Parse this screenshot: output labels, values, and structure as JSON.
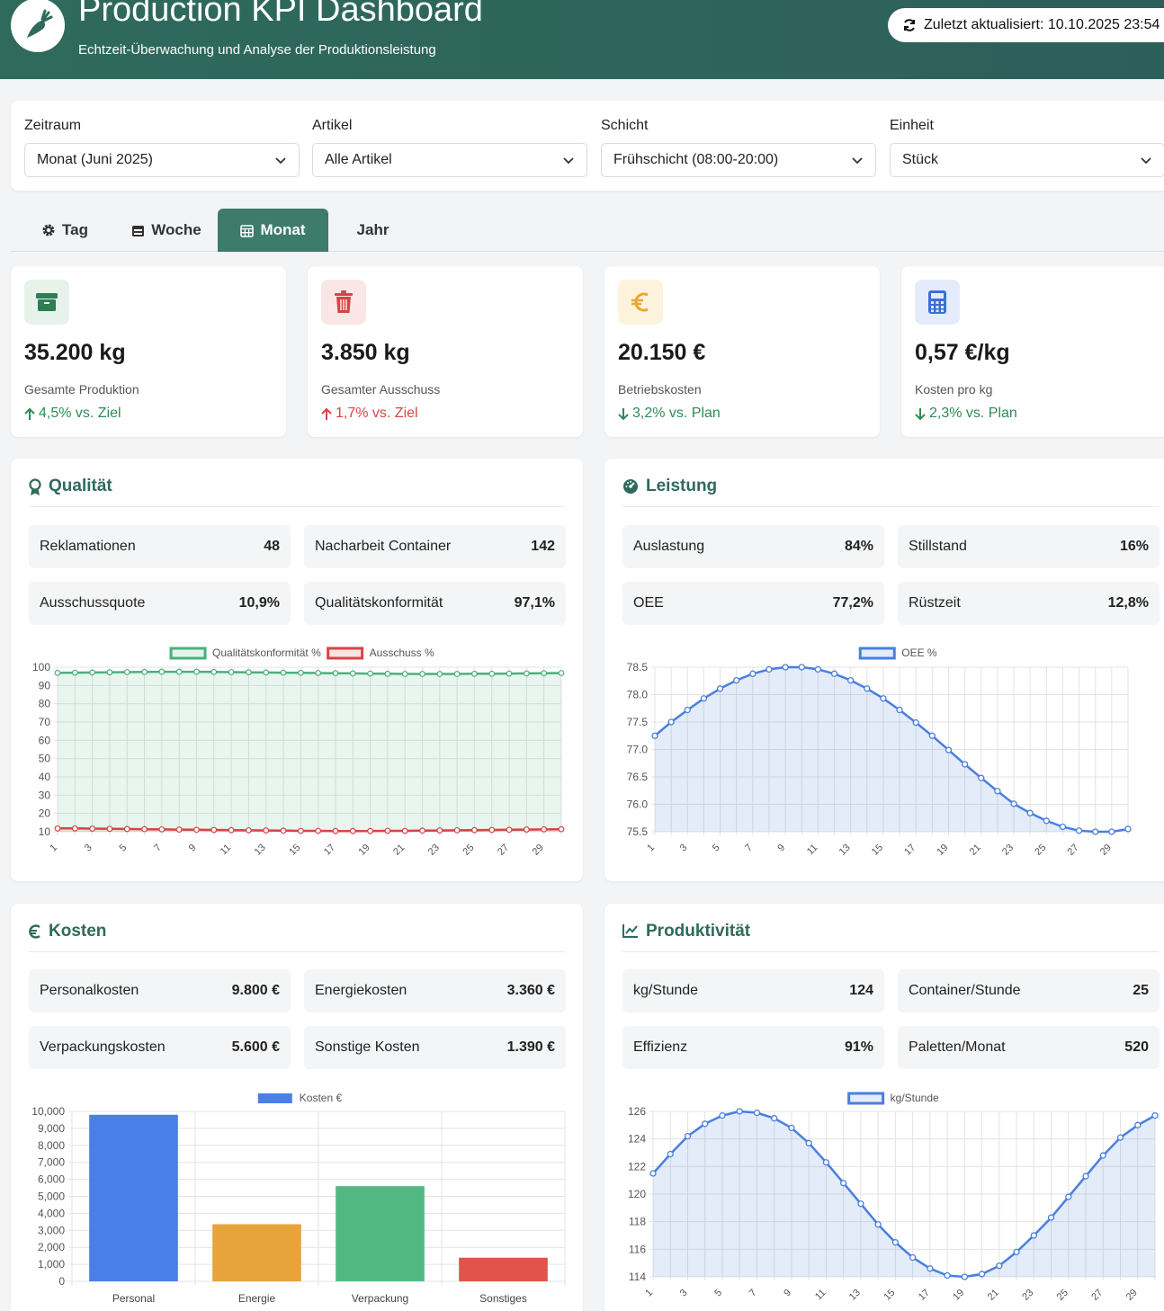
{
  "header": {
    "title": "Production KPI Dashboard",
    "subtitle": "Echtzeit-Überwachung und Analyse der Produktionsleistung",
    "updated": "Zuletzt aktualisiert: 10.10.2025 23:54"
  },
  "filters": [
    {
      "label": "Zeitraum",
      "value": "Monat (Juni 2025)"
    },
    {
      "label": "Artikel",
      "value": "Alle Artikel"
    },
    {
      "label": "Schicht",
      "value": "Frühschicht (08:00-20:00)"
    },
    {
      "label": "Einheit",
      "value": "Stück"
    }
  ],
  "tabs": [
    "Tag",
    "Woche",
    "Monat",
    "Jahr"
  ],
  "active_tab": "Monat",
  "kpis": [
    {
      "value": "35.200 kg",
      "label": "Gesamte Produktion",
      "trend": "4,5% vs. Ziel",
      "direction": "up",
      "color": "#2e8b57",
      "icon": "box-icon"
    },
    {
      "value": "3.850 kg",
      "label": "Gesamter Ausschuss",
      "trend": "1,7% vs. Ziel",
      "direction": "up",
      "color": "#d64545",
      "icon": "trash-icon"
    },
    {
      "value": "20.150 €",
      "label": "Betriebskosten",
      "trend": "3,2% vs. Plan",
      "direction": "down",
      "color": "#2e8b57",
      "icon": "euro-icon"
    },
    {
      "value": "0,57 €/kg",
      "label": "Kosten pro kg",
      "trend": "2,3% vs. Plan",
      "direction": "down",
      "color": "#2e8b57",
      "icon": "calculator-icon"
    }
  ],
  "quality": {
    "title": "Qualität",
    "metrics": [
      {
        "label": "Reklamationen",
        "value": "48"
      },
      {
        "label": "Nacharbeit Container",
        "value": "142"
      },
      {
        "label": "Ausschussquote",
        "value": "10,9%"
      },
      {
        "label": "Qualitätskonformität",
        "value": "97,1%"
      }
    ]
  },
  "performance": {
    "title": "Leistung",
    "metrics": [
      {
        "label": "Auslastung",
        "value": "84%"
      },
      {
        "label": "Stillstand",
        "value": "16%"
      },
      {
        "label": "OEE",
        "value": "77,2%"
      },
      {
        "label": "Rüstzeit",
        "value": "12,8%"
      }
    ]
  },
  "costs": {
    "title": "Kosten",
    "metrics": [
      {
        "label": "Personalkosten",
        "value": "9.800 €"
      },
      {
        "label": "Energiekosten",
        "value": "3.360 €"
      },
      {
        "label": "Verpackungskosten",
        "value": "5.600 €"
      },
      {
        "label": "Sonstige Kosten",
        "value": "1.390 €"
      }
    ]
  },
  "productivity": {
    "title": "Produktivität",
    "metrics": [
      {
        "label": "kg/Stunde",
        "value": "124"
      },
      {
        "label": "Container/Stunde",
        "value": "25"
      },
      {
        "label": "Effizienz",
        "value": "91%"
      },
      {
        "label": "Paletten/Monat",
        "value": "520"
      }
    ]
  },
  "chart_data": [
    {
      "type": "line",
      "x": [
        1,
        2,
        3,
        4,
        5,
        6,
        7,
        8,
        9,
        10,
        11,
        12,
        13,
        14,
        15,
        16,
        17,
        18,
        19,
        20,
        21,
        22,
        23,
        24,
        25,
        26,
        27,
        28,
        29,
        30
      ],
      "series": [
        {
          "name": "Qualitätskonformität %",
          "color": "#4caf7d",
          "values": [
            96.9,
            97.0,
            97.1,
            97.2,
            97.3,
            97.4,
            97.5,
            97.5,
            97.5,
            97.4,
            97.3,
            97.2,
            97.1,
            97.0,
            96.9,
            96.8,
            96.7,
            96.6,
            96.5,
            96.4,
            96.3,
            96.3,
            96.3,
            96.3,
            96.4,
            96.4,
            96.5,
            96.6,
            96.7,
            96.8
          ]
        },
        {
          "name": "Ausschuss %",
          "color": "#d64545",
          "values": [
            11.8,
            11.8,
            11.7,
            11.6,
            11.5,
            11.4,
            11.3,
            11.2,
            11.1,
            11.0,
            10.9,
            10.8,
            10.7,
            10.6,
            10.5,
            10.5,
            10.4,
            10.4,
            10.4,
            10.5,
            10.5,
            10.6,
            10.7,
            10.8,
            10.9,
            11.0,
            11.1,
            11.2,
            11.3,
            11.4
          ]
        }
      ],
      "ylim": [
        10,
        100
      ],
      "yticks": [
        10,
        20,
        30,
        40,
        50,
        60,
        70,
        80,
        90,
        100
      ],
      "xticks": [
        1,
        3,
        5,
        7,
        9,
        11,
        13,
        15,
        17,
        19,
        21,
        23,
        25,
        27,
        29
      ],
      "legend": "top"
    },
    {
      "type": "line",
      "x": [
        1,
        2,
        3,
        4,
        5,
        6,
        7,
        8,
        9,
        10,
        11,
        12,
        13,
        14,
        15,
        16,
        17,
        18,
        19,
        20,
        21,
        22,
        23,
        24,
        25,
        26,
        27,
        28,
        29,
        30
      ],
      "series": [
        {
          "name": "OEE %",
          "color": "#4a7fe0",
          "values": [
            77.25,
            77.5,
            77.72,
            77.93,
            78.11,
            78.26,
            78.38,
            78.46,
            78.5,
            78.5,
            78.46,
            78.38,
            78.26,
            78.11,
            77.93,
            77.72,
            77.49,
            77.25,
            76.99,
            76.73,
            76.48,
            76.24,
            76.01,
            75.84,
            75.7,
            75.59,
            75.52,
            75.5,
            75.5,
            75.55
          ]
        }
      ],
      "ylim": [
        75.5,
        78.5
      ],
      "yticks": [
        "75.5",
        "76.0",
        "76.5",
        "77.0",
        "77.5",
        "78.0",
        "78.5"
      ],
      "xticks": [
        1,
        3,
        5,
        7,
        9,
        11,
        13,
        15,
        17,
        19,
        21,
        23,
        25,
        27,
        29
      ],
      "legend": "top"
    },
    {
      "type": "bar",
      "categories": [
        "Personal",
        "Energie",
        "Verpackung",
        "Sonstiges"
      ],
      "series": [
        {
          "name": "Kosten €",
          "values": [
            9800,
            3360,
            5600,
            1390
          ]
        }
      ],
      "colors": [
        "#4a7fe8",
        "#e8a33a",
        "#52b883",
        "#e0544c"
      ],
      "ylim": [
        0,
        10000
      ],
      "yticks": [
        "0",
        "1,000",
        "2,000",
        "3,000",
        "4,000",
        "5,000",
        "6,000",
        "7,000",
        "8,000",
        "9,000",
        "10,000"
      ],
      "legend": "top"
    },
    {
      "type": "line",
      "x": [
        1,
        2,
        3,
        4,
        5,
        6,
        7,
        8,
        9,
        10,
        11,
        12,
        13,
        14,
        15,
        16,
        17,
        18,
        19,
        20,
        21,
        22,
        23,
        24,
        25,
        26,
        27,
        28,
        29,
        30
      ],
      "series": [
        {
          "name": "kg/Stunde",
          "color": "#4a7fe0",
          "values": [
            121.5,
            122.9,
            124.2,
            125.1,
            125.7,
            126.0,
            125.9,
            125.5,
            124.8,
            123.7,
            122.3,
            120.8,
            119.3,
            117.8,
            116.5,
            115.4,
            114.6,
            114.1,
            114.0,
            114.2,
            114.8,
            115.8,
            117.0,
            118.3,
            119.8,
            121.3,
            122.8,
            124.1,
            125.0,
            125.7
          ]
        }
      ],
      "ylim": [
        114,
        126
      ],
      "yticks": [
        114,
        116,
        118,
        120,
        122,
        124,
        126
      ],
      "xticks": [
        1,
        3,
        5,
        7,
        9,
        11,
        13,
        15,
        17,
        19,
        21,
        23,
        25,
        27,
        29
      ],
      "legend": "top"
    }
  ]
}
